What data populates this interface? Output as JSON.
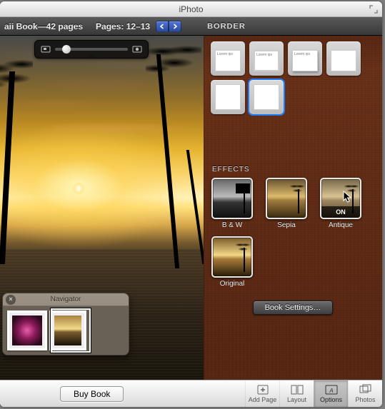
{
  "app_title": "iPhoto",
  "header": {
    "book_title": "aii Book—42 pages",
    "pages_label": "Pages: 12–13"
  },
  "panel": {
    "border_label": "BORDER",
    "border_caption": "Lorem ips",
    "effects_label": "EFFECTS",
    "effects": {
      "bw": "B & W",
      "sepia": "Sepia",
      "antique": "Antique",
      "antique_state": "ON",
      "original": "Original"
    },
    "book_settings": "Book Settings…"
  },
  "navigator": {
    "title": "Navigator"
  },
  "toolbar": {
    "buy": "Buy Book",
    "add_page": "Add Page",
    "layout": "Layout",
    "options": "Options",
    "photos": "Photos"
  }
}
